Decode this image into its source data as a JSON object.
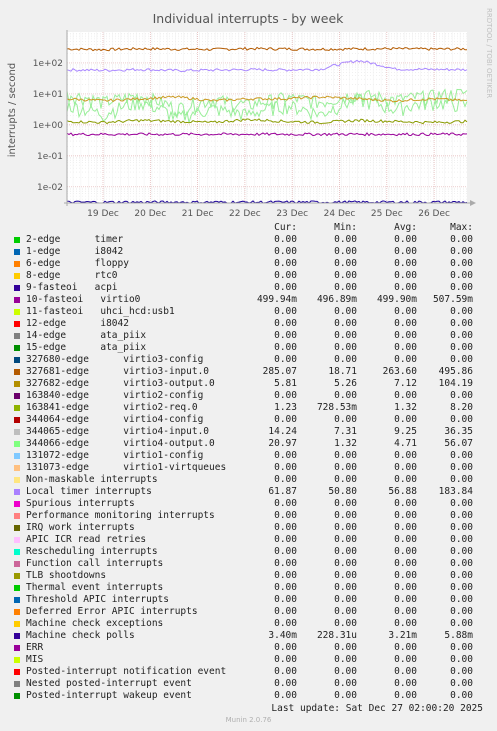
{
  "title": "Individual interrupts - by week",
  "watermark": "RRDTOOL / TOBI OETIKER",
  "chart_data": {
    "type": "line",
    "ylabel": "interrupts / second",
    "yscale": "log",
    "ylim": [
      0.003,
      1000
    ],
    "yticks": [
      "1e+02",
      "1e+01",
      "1e+00",
      "1e-01",
      "1e-02"
    ],
    "ytick_values": [
      100,
      10,
      1,
      0.1,
      0.01
    ],
    "xticks": [
      "19 Dec",
      "20 Dec",
      "21 Dec",
      "22 Dec",
      "23 Dec",
      "24 Dec",
      "25 Dec",
      "26 Dec"
    ],
    "series": [
      {
        "name": "virtio3-input.0",
        "color": "#b35a00",
        "approx": [
          285,
          270,
          290,
          280,
          275,
          290,
          285,
          280,
          285,
          290,
          280,
          285
        ]
      },
      {
        "name": "Local timer interrupts",
        "color": "#aa88ff",
        "approx": [
          60,
          58,
          62,
          57,
          59,
          61,
          60,
          63,
          120,
          64,
          62,
          61
        ]
      },
      {
        "name": "virtio4-input.0",
        "color": "#99ee99",
        "approx": [
          9,
          5,
          8,
          3,
          6,
          4,
          7,
          5,
          9,
          6,
          8,
          10
        ]
      },
      {
        "name": "virtio4-output.0",
        "color": "#99ee99",
        "approx": [
          4,
          2,
          5,
          1.5,
          3,
          2,
          4,
          2,
          6,
          3,
          5,
          4
        ]
      },
      {
        "name": "virtio3-output.0",
        "color": "#cc9922",
        "approx": [
          7,
          6,
          7,
          8,
          6,
          7,
          7,
          8,
          7,
          6,
          7,
          6
        ]
      },
      {
        "name": "virtio2-req.0",
        "color": "#8a9a00",
        "approx": [
          1.3,
          1.2,
          1.4,
          1.3,
          1.2,
          1.5,
          1.3,
          1.2,
          1.4,
          1.3,
          1.2,
          1.3
        ]
      },
      {
        "name": "10-fasteoi virtio0",
        "color": "#990099",
        "approx": [
          0.5,
          0.5,
          0.5,
          0.5,
          0.5,
          0.5,
          0.5,
          0.5,
          0.5,
          0.5,
          0.5,
          0.5
        ]
      },
      {
        "name": "Machine check polls",
        "color": "#1a0099",
        "approx": [
          0.0032,
          0.0032,
          0.0032,
          0.0032,
          0.0032,
          0.0032,
          0.0032,
          0.0032,
          0.0032,
          0.0032,
          0.0032,
          0.0032
        ]
      }
    ]
  },
  "legend_header": {
    "cur": "Cur:",
    "min": "Min:",
    "avg": "Avg:",
    "max": "Max:"
  },
  "legend": [
    {
      "label": "2-edge      timer",
      "color": "#00cc00",
      "cur": "0.00",
      "min": "0.00",
      "avg": "0.00",
      "max": "0.00"
    },
    {
      "label": "1-edge      i8042",
      "color": "#0066b3",
      "cur": "0.00",
      "min": "0.00",
      "avg": "0.00",
      "max": "0.00"
    },
    {
      "label": "6-edge      floppy",
      "color": "#ff8000",
      "cur": "0.00",
      "min": "0.00",
      "avg": "0.00",
      "max": "0.00"
    },
    {
      "label": "8-edge      rtc0",
      "color": "#ffcc00",
      "cur": "0.00",
      "min": "0.00",
      "avg": "0.00",
      "max": "0.00"
    },
    {
      "label": "9-fasteoi   acpi",
      "color": "#330099",
      "cur": "0.00",
      "min": "0.00",
      "avg": "0.00",
      "max": "0.00"
    },
    {
      "label": "10-fasteoi   virtio0",
      "color": "#990099",
      "cur": "499.94m",
      "min": "496.89m",
      "avg": "499.90m",
      "max": "507.59m"
    },
    {
      "label": "11-fasteoi   uhci_hcd:usb1",
      "color": "#ccff00",
      "cur": "0.00",
      "min": "0.00",
      "avg": "0.00",
      "max": "0.00"
    },
    {
      "label": "12-edge      i8042",
      "color": "#ff0000",
      "cur": "0.00",
      "min": "0.00",
      "avg": "0.00",
      "max": "0.00"
    },
    {
      "label": "14-edge      ata_piix",
      "color": "#808080",
      "cur": "0.00",
      "min": "0.00",
      "avg": "0.00",
      "max": "0.00"
    },
    {
      "label": "15-edge      ata_piix",
      "color": "#008f00",
      "cur": "0.00",
      "min": "0.00",
      "avg": "0.00",
      "max": "0.00"
    },
    {
      "label": "327680-edge      virtio3-config",
      "color": "#00487d",
      "cur": "0.00",
      "min": "0.00",
      "avg": "0.00",
      "max": "0.00"
    },
    {
      "label": "327681-edge      virtio3-input.0",
      "color": "#b35a00",
      "cur": "285.07",
      "min": "18.71",
      "avg": "263.60",
      "max": "495.86"
    },
    {
      "label": "327682-edge      virtio3-output.0",
      "color": "#b38f00",
      "cur": "5.81",
      "min": "5.26",
      "avg": "7.12",
      "max": "104.19"
    },
    {
      "label": "163840-edge      virtio2-config",
      "color": "#6b006b",
      "cur": "0.00",
      "min": "0.00",
      "avg": "0.00",
      "max": "0.00"
    },
    {
      "label": "163841-edge      virtio2-req.0",
      "color": "#8fb300",
      "cur": "1.23",
      "min": "728.53m",
      "avg": "1.32",
      "max": "8.20"
    },
    {
      "label": "344064-edge      virtio4-config",
      "color": "#b30000",
      "cur": "0.00",
      "min": "0.00",
      "avg": "0.00",
      "max": "0.00"
    },
    {
      "label": "344065-edge      virtio4-input.0",
      "color": "#bebebe",
      "cur": "14.24",
      "min": "7.31",
      "avg": "9.25",
      "max": "36.35"
    },
    {
      "label": "344066-edge      virtio4-output.0",
      "color": "#80ff80",
      "cur": "20.97",
      "min": "1.32",
      "avg": "4.71",
      "max": "56.07"
    },
    {
      "label": "131072-edge      virtio1-config",
      "color": "#80c9ff",
      "cur": "0.00",
      "min": "0.00",
      "avg": "0.00",
      "max": "0.00"
    },
    {
      "label": "131073-edge      virtio1-virtqueues",
      "color": "#ffc080",
      "cur": "0.00",
      "min": "0.00",
      "avg": "0.00",
      "max": "0.00"
    },
    {
      "label": "Non-maskable interrupts",
      "color": "#ffe680",
      "cur": "0.00",
      "min": "0.00",
      "avg": "0.00",
      "max": "0.00"
    },
    {
      "label": "Local timer interrupts",
      "color": "#aa80ff",
      "cur": "61.87",
      "min": "50.80",
      "avg": "56.88",
      "max": "183.84"
    },
    {
      "label": "Spurious interrupts",
      "color": "#ee00cc",
      "cur": "0.00",
      "min": "0.00",
      "avg": "0.00",
      "max": "0.00"
    },
    {
      "label": "Performance monitoring interrupts",
      "color": "#ff8080",
      "cur": "0.00",
      "min": "0.00",
      "avg": "0.00",
      "max": "0.00"
    },
    {
      "label": "IRQ work interrupts",
      "color": "#666600",
      "cur": "0.00",
      "min": "0.00",
      "avg": "0.00",
      "max": "0.00"
    },
    {
      "label": "APIC ICR read retries",
      "color": "#ffbfff",
      "cur": "0.00",
      "min": "0.00",
      "avg": "0.00",
      "max": "0.00"
    },
    {
      "label": "Rescheduling interrupts",
      "color": "#00ffcc",
      "cur": "0.00",
      "min": "0.00",
      "avg": "0.00",
      "max": "0.00"
    },
    {
      "label": "Function call interrupts",
      "color": "#cc6699",
      "cur": "0.00",
      "min": "0.00",
      "avg": "0.00",
      "max": "0.00"
    },
    {
      "label": "TLB shootdowns",
      "color": "#999900",
      "cur": "0.00",
      "min": "0.00",
      "avg": "0.00",
      "max": "0.00"
    },
    {
      "label": "Thermal event interrupts",
      "color": "#00cc00",
      "cur": "0.00",
      "min": "0.00",
      "avg": "0.00",
      "max": "0.00"
    },
    {
      "label": "Threshold APIC interrupts",
      "color": "#0066b3",
      "cur": "0.00",
      "min": "0.00",
      "avg": "0.00",
      "max": "0.00"
    },
    {
      "label": "Deferred Error APIC interrupts",
      "color": "#ff8000",
      "cur": "0.00",
      "min": "0.00",
      "avg": "0.00",
      "max": "0.00"
    },
    {
      "label": "Machine check exceptions",
      "color": "#ffcc00",
      "cur": "0.00",
      "min": "0.00",
      "avg": "0.00",
      "max": "0.00"
    },
    {
      "label": "Machine check polls",
      "color": "#330099",
      "cur": "3.40m",
      "min": "228.31u",
      "avg": "3.21m",
      "max": "5.88m"
    },
    {
      "label": "ERR",
      "color": "#990099",
      "cur": "0.00",
      "min": "0.00",
      "avg": "0.00",
      "max": "0.00"
    },
    {
      "label": "MIS",
      "color": "#ccff00",
      "cur": "0.00",
      "min": "0.00",
      "avg": "0.00",
      "max": "0.00"
    },
    {
      "label": "Posted-interrupt notification event",
      "color": "#ff0000",
      "cur": "0.00",
      "min": "0.00",
      "avg": "0.00",
      "max": "0.00"
    },
    {
      "label": "Nested posted-interrupt event",
      "color": "#808080",
      "cur": "0.00",
      "min": "0.00",
      "avg": "0.00",
      "max": "0.00"
    },
    {
      "label": "Posted-interrupt wakeup event",
      "color": "#008f00",
      "cur": "0.00",
      "min": "0.00",
      "avg": "0.00",
      "max": "0.00"
    }
  ],
  "last_update": "Last update: Sat Dec 27 02:00:20 2025",
  "footer": "Munin 2.0.76"
}
